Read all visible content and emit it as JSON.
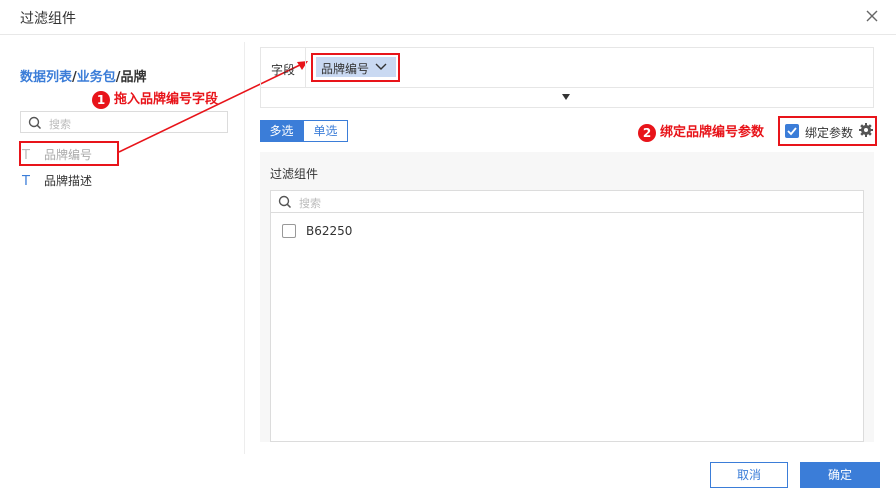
{
  "dialog": {
    "title": "过滤组件"
  },
  "left": {
    "breadcrumb": {
      "part1": "数据列表",
      "sep1": "/",
      "part2": "业务包",
      "sep2": "/",
      "part3": "品牌"
    },
    "search_placeholder": "搜索",
    "fields": [
      {
        "type_icon": "T",
        "label": "品牌编号"
      },
      {
        "type_icon": "T",
        "label": "品牌描述"
      }
    ]
  },
  "annotations": {
    "step1_num": "1",
    "step1_text": "拖入品牌编号字段",
    "step2_num": "2",
    "step2_text": "绑定品牌编号参数",
    "highlight_color": "#e8141a"
  },
  "right": {
    "field_label": "字段",
    "field_chip": "品牌编号",
    "tabs": {
      "multi": "多选",
      "single": "单选",
      "active": "多选"
    },
    "bind_param": {
      "label": "绑定参数",
      "checked": true
    },
    "panel": {
      "title": "过滤组件",
      "search_placeholder": "搜索",
      "options": [
        {
          "label": "B62250",
          "checked": false
        }
      ]
    }
  },
  "footer": {
    "cancel": "取消",
    "ok": "确定"
  },
  "colors": {
    "accent": "#3b7dd8",
    "chip_bg": "#c9d9f2"
  }
}
